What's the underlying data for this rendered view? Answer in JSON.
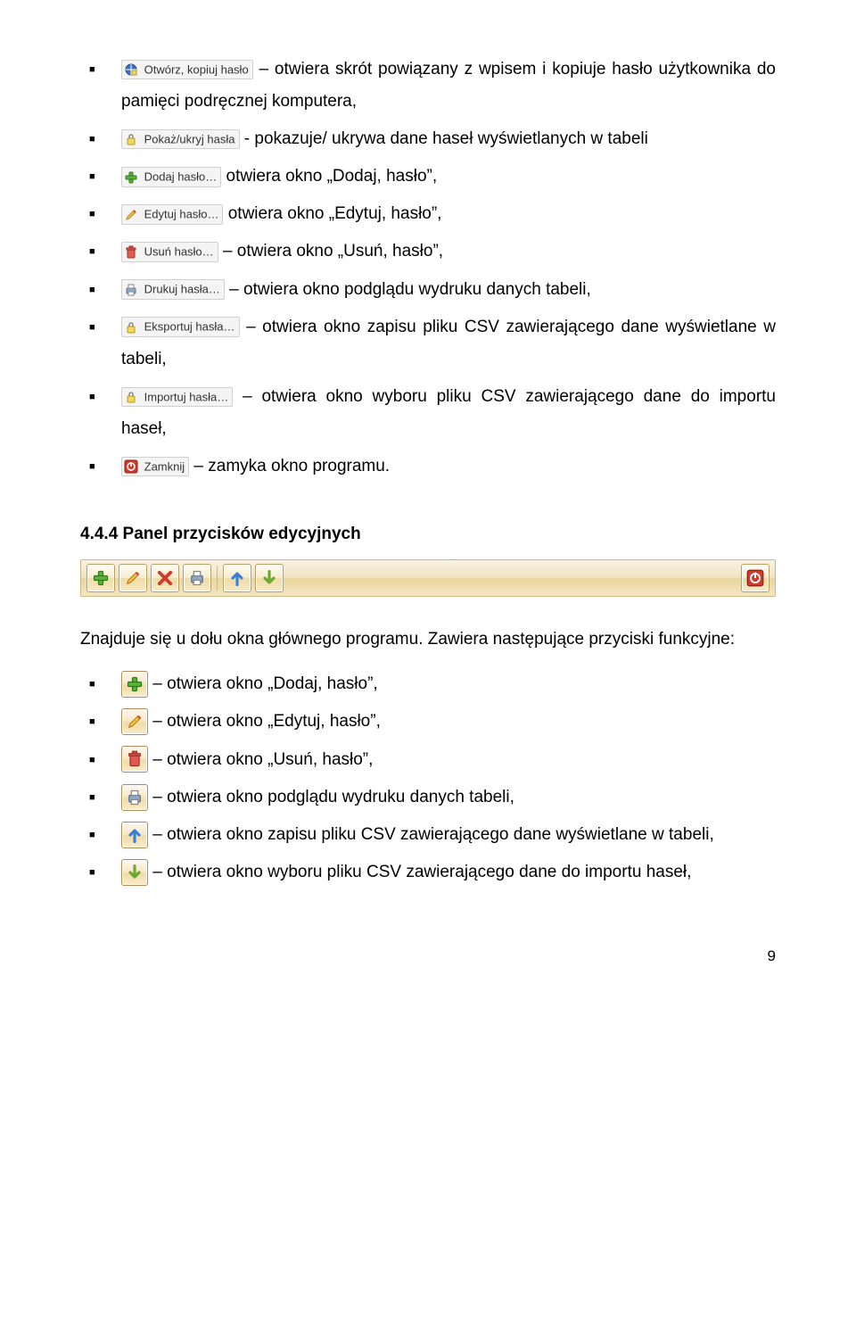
{
  "menu_items": {
    "open_copy": {
      "label": "Otwórz, kopiuj hasło",
      "desc": " – otwiera skrót powiązany z wpisem i kopiuje hasło użytkownika do pamięci podręcznej komputera,"
    },
    "show_hide": {
      "label": "Pokaż/ukryj hasła",
      "desc": " - pokazuje/ ukrywa dane haseł wyświetlanych w tabeli"
    },
    "add": {
      "label": "Dodaj hasło…",
      "desc": " otwiera okno „Dodaj, hasło”,"
    },
    "edit": {
      "label": "Edytuj hasło…",
      "desc": " otwiera okno „Edytuj, hasło”,"
    },
    "delete": {
      "label": "Usuń hasło…",
      "desc": " – otwiera okno „Usuń, hasło”,"
    },
    "print": {
      "label": "Drukuj hasła…",
      "desc": " – otwiera okno podglądu wydruku danych tabeli,"
    },
    "export": {
      "label": "Eksportuj hasła…",
      "desc": " – otwiera okno zapisu pliku CSV zawierającego dane wyświetlane w tabeli,"
    },
    "import": {
      "label": "Importuj hasła…",
      "desc": " – otwiera okno wyboru pliku CSV zawierającego dane do importu haseł,"
    },
    "close": {
      "label": "Zamknij",
      "desc": " – zamyka okno programu."
    }
  },
  "section_title": "4.4.4 Panel przycisków edycyjnych",
  "para_intro": "Znajduje się u dołu okna głównego programu. Zawiera następujące przyciski funkcyjne:",
  "buttons_list": {
    "add": " – otwiera okno „Dodaj, hasło”,",
    "edit": " – otwiera okno „Edytuj, hasło”,",
    "delete": " – otwiera okno „Usuń, hasło”,",
    "print": " – otwiera okno podglądu wydruku danych tabeli,",
    "export": " – otwiera okno zapisu pliku CSV zawierającego dane wyświetlane w tabeli,",
    "import": " – otwiera okno wyboru pliku CSV zawierającego dane do importu haseł,"
  },
  "page_number": "9"
}
